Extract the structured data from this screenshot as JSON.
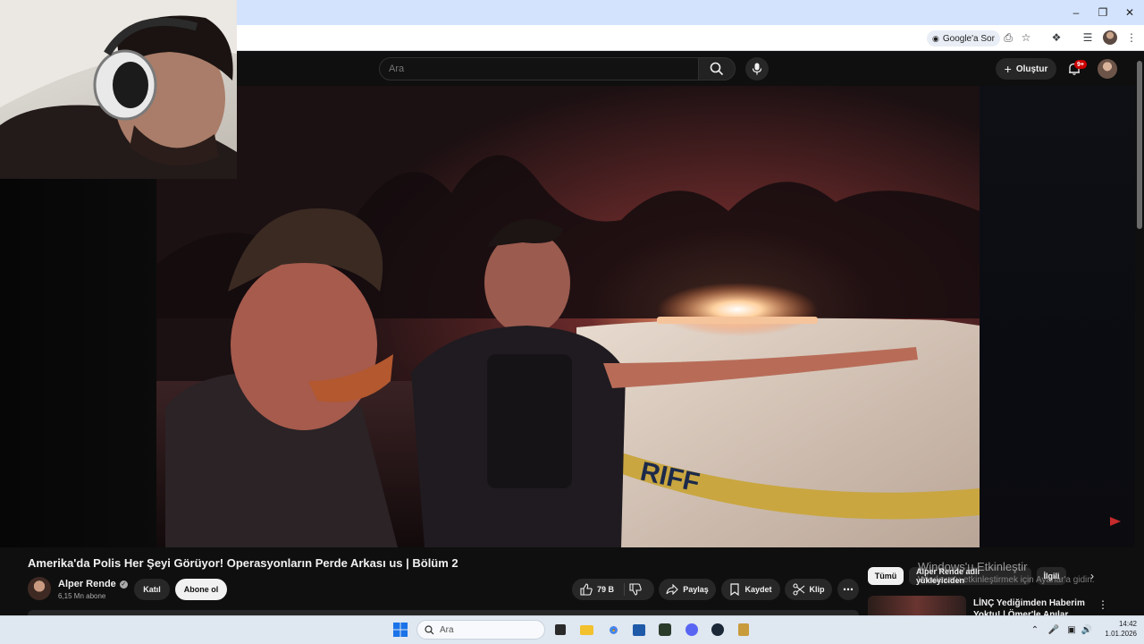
{
  "browser": {
    "google_ask": "Google'a Sor"
  },
  "header": {
    "search_placeholder": "Ara",
    "create_label": "Oluştur",
    "notifications_badge": "9+"
  },
  "video": {
    "title": "Amerika'da Polis Her Şeyi Görüyor! Operasyonların Perde Arkası us | Bölüm 2",
    "channel_name": "Alper Rende",
    "subscribers": "6,15 Mn abone",
    "join_label": "Katıl",
    "subscribe_label": "Abone ol",
    "likes": "79 B",
    "share_label": "Paylaş",
    "save_label": "Kaydet",
    "clip_label": "Klip"
  },
  "sidebar": {
    "chips": [
      {
        "label": "Tümü"
      },
      {
        "label": "Alper Rende adlı yükleyiciden"
      },
      {
        "label": "İlgili"
      }
    ],
    "suggestion_title": "LİNÇ Yediğimden Haberim Yoktu! | Ömer'le Anılar @gokalaf"
  },
  "watermark": {
    "line1": "Windows'u Etkinleştir",
    "line2": "Windows'u etkinleştirmek için Ayarlar'a gidin."
  },
  "taskbar": {
    "search_placeholder": "Ara",
    "time": "14:42",
    "date": "1.01.2026"
  },
  "colors": {
    "youtube_bg": "#0f0f0f",
    "pill_bg": "#272727",
    "notification_red": "#cc0000",
    "chrome_top": "#d3e3fd"
  }
}
